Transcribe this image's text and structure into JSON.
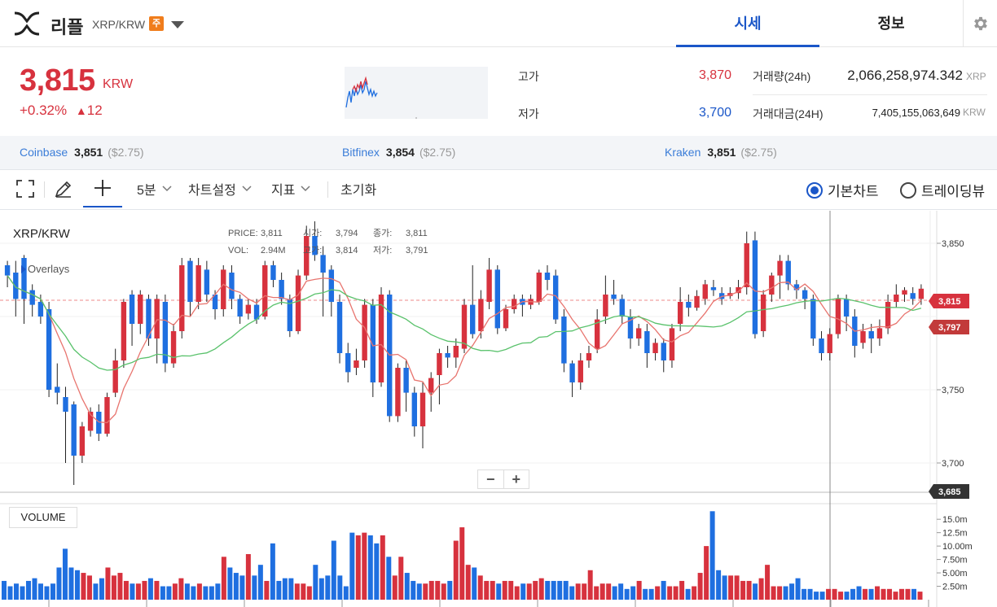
{
  "header": {
    "coin_name": "리플",
    "pair": "XRP/KRW",
    "badge": "주",
    "tabs": [
      {
        "label": "시세",
        "active": true
      },
      {
        "label": "정보",
        "active": false
      }
    ]
  },
  "ticker": {
    "price": "3,815",
    "unit": "KRW",
    "change_pct": "+0.32%",
    "change_arrow": "▲",
    "change_abs": "12",
    "high_label": "고가",
    "high": "3,870",
    "low_label": "저가",
    "low": "3,700",
    "volume_label": "거래량(24h)",
    "volume": "2,066,258,974.342",
    "volume_unit": "XRP",
    "amount_label": "거래대금(24H)",
    "amount": "7,405,155,063,649",
    "amount_unit": "KRW"
  },
  "exchanges": [
    {
      "name": "Coinbase",
      "price": "3,851",
      "usd": "($2.75)"
    },
    {
      "name": "Bitfinex",
      "price": "3,854",
      "usd": "($2.75)"
    },
    {
      "name": "Kraken",
      "price": "3,851",
      "usd": "($2.75)"
    }
  ],
  "toolbar": {
    "interval": "5분",
    "chart_settings": "차트설정",
    "indicators": "지표",
    "reset": "초기화",
    "basic_chart": "기본차트",
    "tradingview": "트레이딩뷰"
  },
  "chart": {
    "title": "XRP/KRW",
    "overlays": "Overlays",
    "price_label": "PRICE:",
    "price_val": "3,811",
    "vol_label": "VOL:",
    "vol_val": "2.94M",
    "open_label": "시가:",
    "open_val": "3,794",
    "close_label": "종가:",
    "close_val": "3,811",
    "high_label": "고가:",
    "high_val": "3,814",
    "low_label": "저가:",
    "low_val": "3,791",
    "volume_panel": "VOLUME",
    "zoom_out": "−",
    "zoom_in": "+",
    "y_ticks": [
      "3,850",
      "3,750",
      "3,700"
    ],
    "tag_current": "3,815",
    "tag_ma": "3,797",
    "tag_cursor": "3,685",
    "vol_ticks": [
      "15.0m",
      "12.5m",
      "10.00m",
      "7.50m",
      "5.00m",
      "2.50m"
    ]
  },
  "chart_data": {
    "type": "candlestick",
    "y_range": [
      3680,
      3870
    ],
    "up_color": "#d7323e",
    "down_color": "#1f6fe0",
    "candles": [
      [
        3835,
        3828,
        3838,
        3820
      ],
      [
        3830,
        3812,
        3838,
        3800
      ],
      [
        3840,
        3812,
        3842,
        3795
      ],
      [
        3818,
        3808,
        3822,
        3800
      ],
      [
        3810,
        3800,
        3815,
        3795
      ],
      [
        3805,
        3750,
        3810,
        3745
      ],
      [
        3752,
        3748,
        3768,
        3740
      ],
      [
        3745,
        3735,
        3752,
        3700
      ],
      [
        3740,
        3705,
        3742,
        3685
      ],
      [
        3705,
        3725,
        3728,
        3700
      ],
      [
        3722,
        3735,
        3738,
        3718
      ],
      [
        3735,
        3720,
        3740,
        3715
      ],
      [
        3720,
        3745,
        3748,
        3718
      ],
      [
        3748,
        3770,
        3778,
        3745
      ],
      [
        3770,
        3810,
        3812,
        3765
      ],
      [
        3815,
        3795,
        3818,
        3780
      ],
      [
        3795,
        3815,
        3818,
        3788
      ],
      [
        3812,
        3785,
        3815,
        3780
      ],
      [
        3785,
        3812,
        3815,
        3768
      ],
      [
        3810,
        3768,
        3815,
        3762
      ],
      [
        3768,
        3790,
        3795,
        3765
      ],
      [
        3790,
        3835,
        3840,
        3785
      ],
      [
        3838,
        3810,
        3840,
        3800
      ],
      [
        3810,
        3835,
        3840,
        3805
      ],
      [
        3832,
        3815,
        3838,
        3810
      ],
      [
        3815,
        3805,
        3818,
        3798
      ],
      [
        3805,
        3832,
        3835,
        3800
      ],
      [
        3830,
        3812,
        3835,
        3805
      ],
      [
        3812,
        3800,
        3815,
        3795
      ],
      [
        3802,
        3808,
        3812,
        3798
      ],
      [
        3808,
        3798,
        3812,
        3795
      ],
      [
        3800,
        3835,
        3838,
        3798
      ],
      [
        3835,
        3825,
        3838,
        3820
      ],
      [
        3825,
        3812,
        3830,
        3808
      ],
      [
        3812,
        3790,
        3815,
        3786
      ],
      [
        3790,
        3828,
        3832,
        3788
      ],
      [
        3828,
        3855,
        3862,
        3825
      ],
      [
        3855,
        3842,
        3865,
        3838
      ],
      [
        3842,
        3830,
        3848,
        3800
      ],
      [
        3832,
        3810,
        3835,
        3800
      ],
      [
        3810,
        3775,
        3815,
        3768
      ],
      [
        3775,
        3762,
        3782,
        3755
      ],
      [
        3765,
        3770,
        3778,
        3760
      ],
      [
        3770,
        3808,
        3812,
        3765
      ],
      [
        3808,
        3755,
        3812,
        3745
      ],
      [
        3755,
        3815,
        3820,
        3752
      ],
      [
        3815,
        3732,
        3818,
        3728
      ],
      [
        3732,
        3765,
        3768,
        3728
      ],
      [
        3765,
        3748,
        3770,
        3735
      ],
      [
        3748,
        3725,
        3752,
        3718
      ],
      [
        3725,
        3748,
        3755,
        3710
      ],
      [
        3748,
        3758,
        3762,
        3735
      ],
      [
        3760,
        3775,
        3778,
        3740
      ],
      [
        3775,
        3772,
        3780,
        3765
      ],
      [
        3772,
        3780,
        3785,
        3765
      ],
      [
        3778,
        3808,
        3812,
        3775
      ],
      [
        3808,
        3788,
        3835,
        3785
      ],
      [
        3790,
        3812,
        3818,
        3785
      ],
      [
        3810,
        3832,
        3840,
        3805
      ],
      [
        3832,
        3792,
        3835,
        3788
      ],
      [
        3792,
        3805,
        3808,
        3790
      ],
      [
        3805,
        3812,
        3815,
        3802
      ],
      [
        3812,
        3808,
        3815,
        3800
      ],
      [
        3808,
        3812,
        3815,
        3805
      ],
      [
        3810,
        3830,
        3832,
        3808
      ],
      [
        3830,
        3825,
        3835,
        3818
      ],
      [
        3828,
        3798,
        3832,
        3795
      ],
      [
        3800,
        3768,
        3805,
        3762
      ],
      [
        3768,
        3755,
        3770,
        3745
      ],
      [
        3755,
        3770,
        3775,
        3750
      ],
      [
        3770,
        3775,
        3780,
        3765
      ],
      [
        3778,
        3798,
        3805,
        3775
      ],
      [
        3800,
        3815,
        3828,
        3795
      ],
      [
        3815,
        3812,
        3825,
        3808
      ],
      [
        3812,
        3800,
        3815,
        3795
      ],
      [
        3800,
        3785,
        3805,
        3778
      ],
      [
        3785,
        3792,
        3795,
        3780
      ],
      [
        3790,
        3775,
        3795,
        3765
      ],
      [
        3775,
        3782,
        3785,
        3770
      ],
      [
        3782,
        3770,
        3785,
        3762
      ],
      [
        3770,
        3792,
        3795,
        3765
      ],
      [
        3795,
        3810,
        3820,
        3790
      ],
      [
        3810,
        3806,
        3815,
        3800
      ],
      [
        3806,
        3814,
        3818,
        3804
      ],
      [
        3812,
        3822,
        3825,
        3808
      ],
      [
        3820,
        3818,
        3825,
        3814
      ],
      [
        3816,
        3812,
        3820,
        3808
      ],
      [
        3814,
        3816,
        3820,
        3812
      ],
      [
        3816,
        3820,
        3825,
        3812
      ],
      [
        3820,
        3850,
        3858,
        3815
      ],
      [
        3852,
        3788,
        3858,
        3785
      ],
      [
        3790,
        3815,
        3818,
        3786
      ],
      [
        3815,
        3828,
        3830,
        3810
      ],
      [
        3828,
        3838,
        3842,
        3812
      ],
      [
        3838,
        3822,
        3842,
        3818
      ],
      [
        3822,
        3818,
        3825,
        3812
      ],
      [
        3818,
        3812,
        3820,
        3805
      ],
      [
        3812,
        3785,
        3815,
        3780
      ],
      [
        3785,
        3775,
        3790,
        3770
      ],
      [
        3775,
        3788,
        3792,
        3770
      ],
      [
        3788,
        3812,
        3815,
        3785
      ],
      [
        3812,
        3800,
        3815,
        3790
      ],
      [
        3800,
        3780,
        3805,
        3772
      ],
      [
        3782,
        3790,
        3795,
        3778
      ],
      [
        3790,
        3785,
        3795,
        3775
      ],
      [
        3785,
        3792,
        3798,
        3780
      ],
      [
        3792,
        3810,
        3815,
        3788
      ],
      [
        3810,
        3815,
        3822,
        3806
      ],
      [
        3815,
        3818,
        3820,
        3810
      ],
      [
        3816,
        3812,
        3820,
        3808
      ],
      [
        3812,
        3819,
        3822,
        3808
      ]
    ],
    "volumes_m": [
      3.5,
      2.5,
      3,
      2.5,
      3.5,
      4,
      3,
      2.5,
      3,
      6,
      9.5,
      6,
      5.5,
      5,
      4.5,
      3,
      4,
      6,
      4.5,
      5,
      3.5,
      3,
      3,
      3.5,
      4,
      3.5,
      2.5,
      2.5,
      3,
      4,
      3,
      2.5,
      3,
      2.5,
      2.5,
      3,
      8,
      6,
      5,
      4.5,
      8.5,
      4.5,
      6.5,
      3.5,
      10.5,
      3.5,
      4,
      4,
      3,
      3,
      2.5,
      6.5,
      4,
      4.5,
      11,
      4.5,
      2.5,
      12.5,
      12,
      12.5,
      12,
      10.5,
      12,
      8,
      4.5,
      8,
      5,
      3.5,
      3,
      3,
      3.5,
      3.5,
      3,
      3.5,
      11,
      13.5,
      6.5,
      6,
      4.5,
      3.5,
      3.5,
      3,
      3.5,
      3.5,
      2.5,
      3,
      3,
      3.5,
      4,
      3.5,
      3.5,
      3.5,
      3.5,
      2.5,
      3,
      3,
      5.5,
      2.5,
      3,
      3,
      2.5,
      3,
      2,
      2.5,
      3.5,
      2,
      2,
      2.5,
      3.5,
      2.5,
      2.5,
      3.5,
      2,
      2.5,
      5,
      10,
      16.5,
      5.5,
      4.5,
      4.5,
      4.5,
      3.5,
      3.5,
      3,
      4,
      6.5,
      2.5,
      2.5,
      2.5,
      3,
      4,
      2,
      2,
      1.5,
      1.5,
      2,
      2,
      1.5,
      1.5,
      2,
      2.5,
      2,
      2,
      2.5,
      2,
      2,
      1.5,
      2,
      2,
      2,
      1.5
    ],
    "ma_short_color": "#e8746e",
    "ma_long_color": "#5ac26c"
  }
}
